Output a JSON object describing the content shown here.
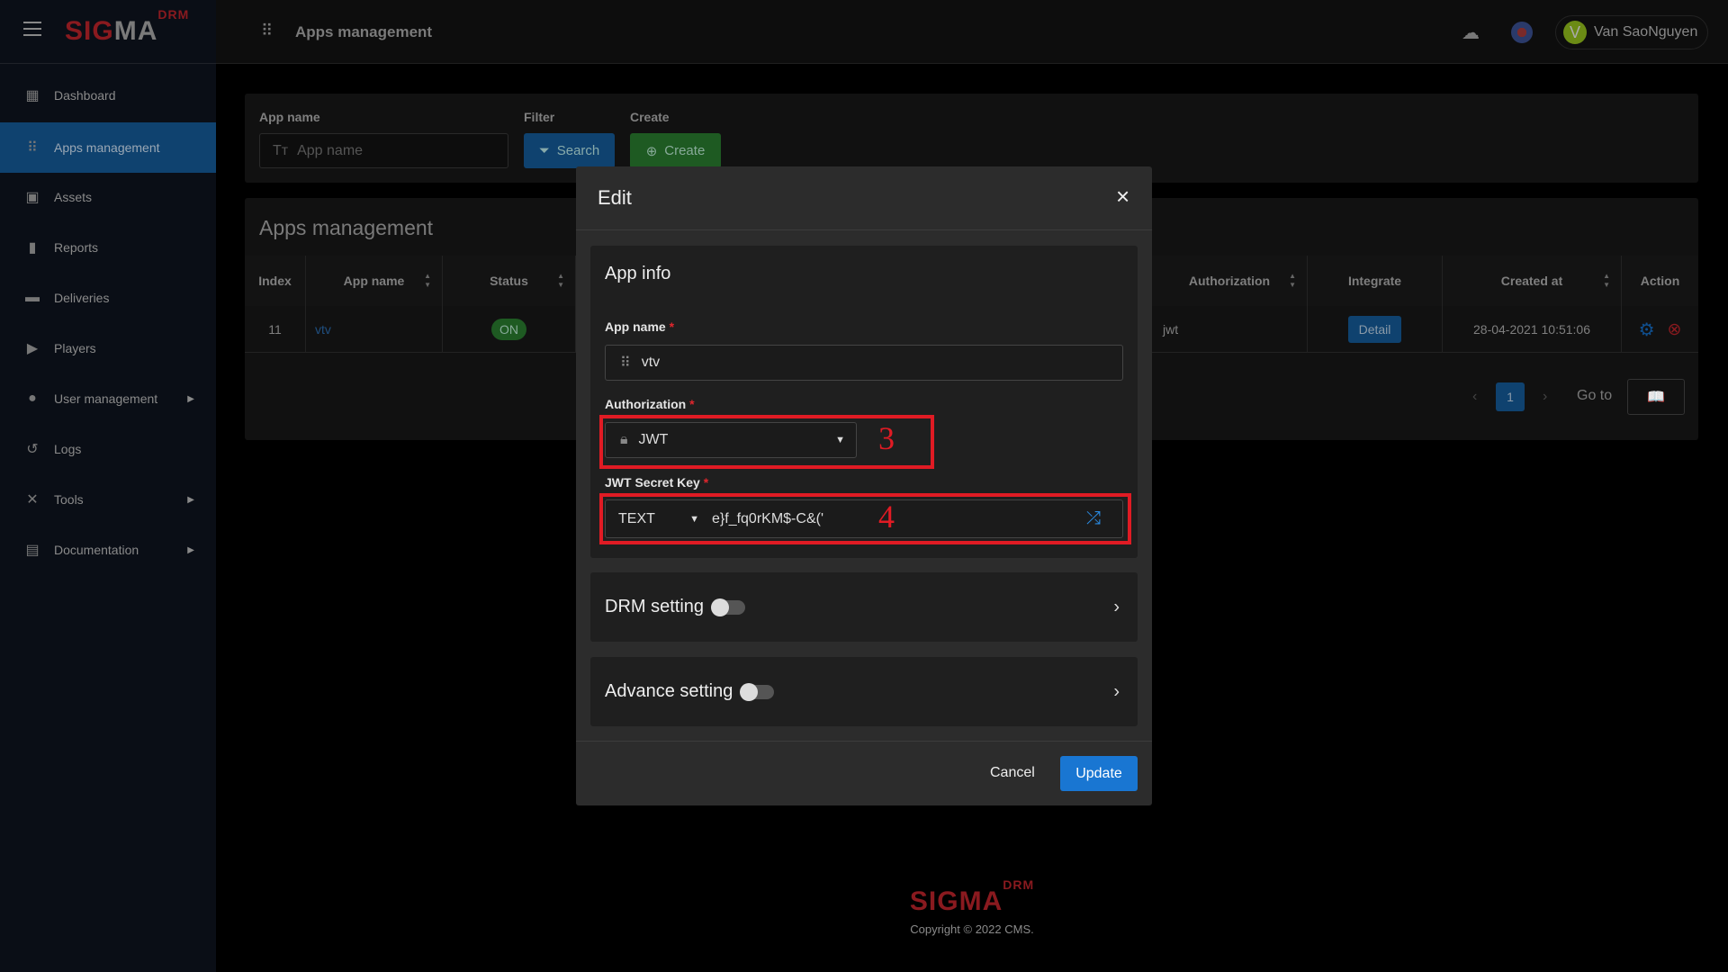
{
  "brand": {
    "logo_main": "SIGMA",
    "logo_sup": "DRM",
    "colors": {
      "accent": "#1976d2",
      "brand_red": "#c62828",
      "success": "#2e7d32"
    }
  },
  "topbar": {
    "title": "Apps management",
    "user_initial": "V",
    "user_name": "Van SaoNguyen",
    "theme_icon": "moon-cloud-icon",
    "language_icon": "uk-flag-icon"
  },
  "sidebar": {
    "items": [
      {
        "label": "Dashboard",
        "icon": "dashboard-icon",
        "active": false
      },
      {
        "label": "Apps management",
        "icon": "apps-icon",
        "active": true
      },
      {
        "label": "Assets",
        "icon": "briefcase-icon",
        "active": false
      },
      {
        "label": "Reports",
        "icon": "bar-chart-icon",
        "active": false
      },
      {
        "label": "Deliveries",
        "icon": "truck-icon",
        "active": false
      },
      {
        "label": "Players",
        "icon": "play-icon",
        "active": false
      },
      {
        "label": "User management",
        "icon": "user-icon",
        "active": false,
        "submenu": true
      },
      {
        "label": "Logs",
        "icon": "history-icon",
        "active": false
      },
      {
        "label": "Tools",
        "icon": "tools-icon",
        "active": false,
        "submenu": true
      },
      {
        "label": "Documentation",
        "icon": "book-icon",
        "active": false,
        "submenu": true
      }
    ]
  },
  "filter": {
    "app_name_label": "App name",
    "app_name_placeholder": "App name",
    "filter_label": "Filter",
    "search_label": "Search",
    "create_label": "Create",
    "create_button": "Create"
  },
  "table": {
    "title": "Apps management",
    "columns": [
      "Index",
      "App name",
      "Status",
      "Authorization",
      "Integrate",
      "Created at",
      "Action"
    ],
    "rows": [
      {
        "index": "11",
        "app_name": "vtv",
        "status": "ON",
        "authorization": "jwt",
        "integrate": "Detail",
        "created_at": "28-04-2021 10:51:06"
      }
    ],
    "pagination": {
      "current": "1",
      "goto_label": "Go to"
    }
  },
  "modal": {
    "title": "Edit",
    "app_info_title": "App info",
    "app_name_label": "App name",
    "app_name_value": "vtv",
    "authorization_label": "Authorization",
    "authorization_value": "JWT",
    "secret_label": "JWT Secret Key",
    "secret_type": "TEXT",
    "secret_value": "e}f_fq0rKM$-C&('",
    "drm_label": "DRM setting",
    "drm_enabled": false,
    "advance_label": "Advance setting",
    "advance_enabled": false,
    "cancel": "Cancel",
    "update": "Update",
    "required_mark": "*",
    "annotations": [
      "3",
      "4"
    ]
  },
  "footer": {
    "copyright": "Copyright © 2022 CMS."
  }
}
